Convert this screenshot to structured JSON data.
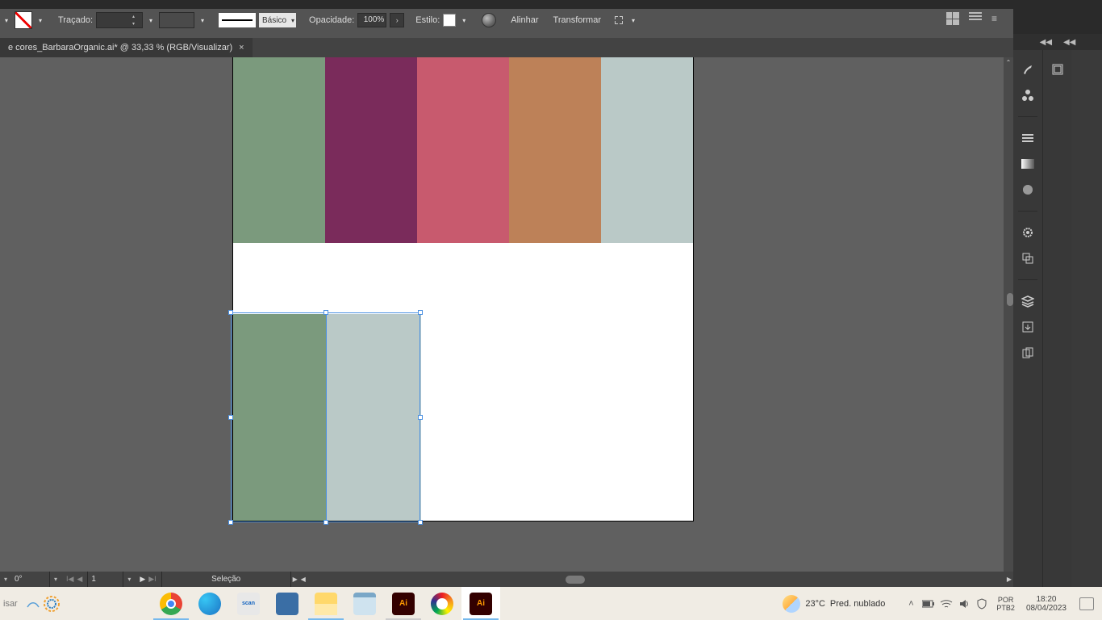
{
  "options": {
    "tracado_label": "Traçado:",
    "profile_label": "Básico",
    "opacidade_label": "Opacidade:",
    "opacidade_value": "100%",
    "estilo_label": "Estilo:",
    "alinhar_label": "Alinhar",
    "transformar_label": "Transformar"
  },
  "doc_tab": {
    "title": "e cores_BarbaraOrganic.ai* @ 33,33 % (RGB/Visualizar)",
    "close": "×"
  },
  "palette": {
    "c1": "#7b9a7d",
    "c2": "#7a2b5b",
    "c3": "#c85a6e",
    "c4": "#bd8158",
    "c5": "#bac9c7"
  },
  "status": {
    "rotate": "0°",
    "artboard_num": "1",
    "tool": "Seleção"
  },
  "taskbar": {
    "search_placeholder": "isar",
    "weather_temp": "23°C",
    "weather_desc": "Pred. nublado",
    "lang1": "POR",
    "lang2": "PTB2",
    "time": "18:20",
    "date": "08/04/2023"
  }
}
